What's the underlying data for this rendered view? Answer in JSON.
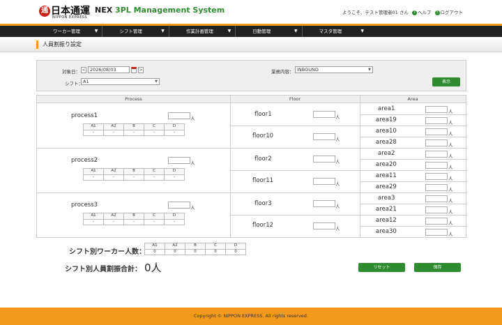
{
  "header": {
    "logo_mark": "通",
    "logo_jp": "日本通運",
    "logo_en": "NIPPON EXPRESS",
    "app_title_main": "NEX",
    "app_title_sub": "3PL Management System",
    "welcome": "ようこそ、テスト管理者01 さん",
    "help_label": "ヘルプ",
    "logout_label": "ログアウト"
  },
  "nav": {
    "items": [
      {
        "label": "ワーカー管理"
      },
      {
        "label": "シフト管理"
      },
      {
        "label": "作業計画管理"
      },
      {
        "label": "日動管理"
      },
      {
        "label": "マスタ管理"
      }
    ],
    "caret": "▼"
  },
  "page": {
    "title": "人員割振り設定"
  },
  "filter": {
    "date_label": "対象日：",
    "date_value": "2026/08/03",
    "prev": "<",
    "next": ">",
    "shift_label": "シフト：",
    "shift_value": "A1",
    "work_label": "業務内容：",
    "work_value": "INBOUND",
    "display_button": "表示"
  },
  "grid": {
    "headers": {
      "process": "Process",
      "floor": "Floor",
      "area": "Area"
    },
    "unit": "人",
    "mini_headers": [
      "A1",
      "A2",
      "B",
      "C",
      "D"
    ],
    "mini_values": [
      "-",
      "-",
      "-",
      "-",
      "-"
    ],
    "processes": [
      {
        "name": "process1",
        "floors": [
          {
            "name": "floor1",
            "areas": [
              "area1",
              "area19"
            ]
          },
          {
            "name": "floor10",
            "areas": [
              "area10",
              "area28"
            ]
          }
        ]
      },
      {
        "name": "process2",
        "floors": [
          {
            "name": "floor2",
            "areas": [
              "area2",
              "area20"
            ]
          },
          {
            "name": "floor11",
            "areas": [
              "area11",
              "area29"
            ]
          }
        ]
      },
      {
        "name": "process3",
        "floors": [
          {
            "name": "floor3",
            "areas": [
              "area3",
              "area21"
            ]
          },
          {
            "name": "floor12",
            "areas": [
              "area12",
              "area30"
            ]
          }
        ]
      }
    ]
  },
  "summary": {
    "workers_label": "シフト別ワーカー人数：",
    "headers": [
      "A1",
      "A2",
      "B",
      "C",
      "D"
    ],
    "values": [
      "0",
      "0",
      "0",
      "0",
      "0"
    ],
    "total_label": "シフト別人員割振合計：",
    "total_value": "0人",
    "reset_button": "リセット",
    "save_button": "保存"
  },
  "footer": {
    "copyright": "Copyright © NIPPON EXPRESS. All rights reserved."
  }
}
